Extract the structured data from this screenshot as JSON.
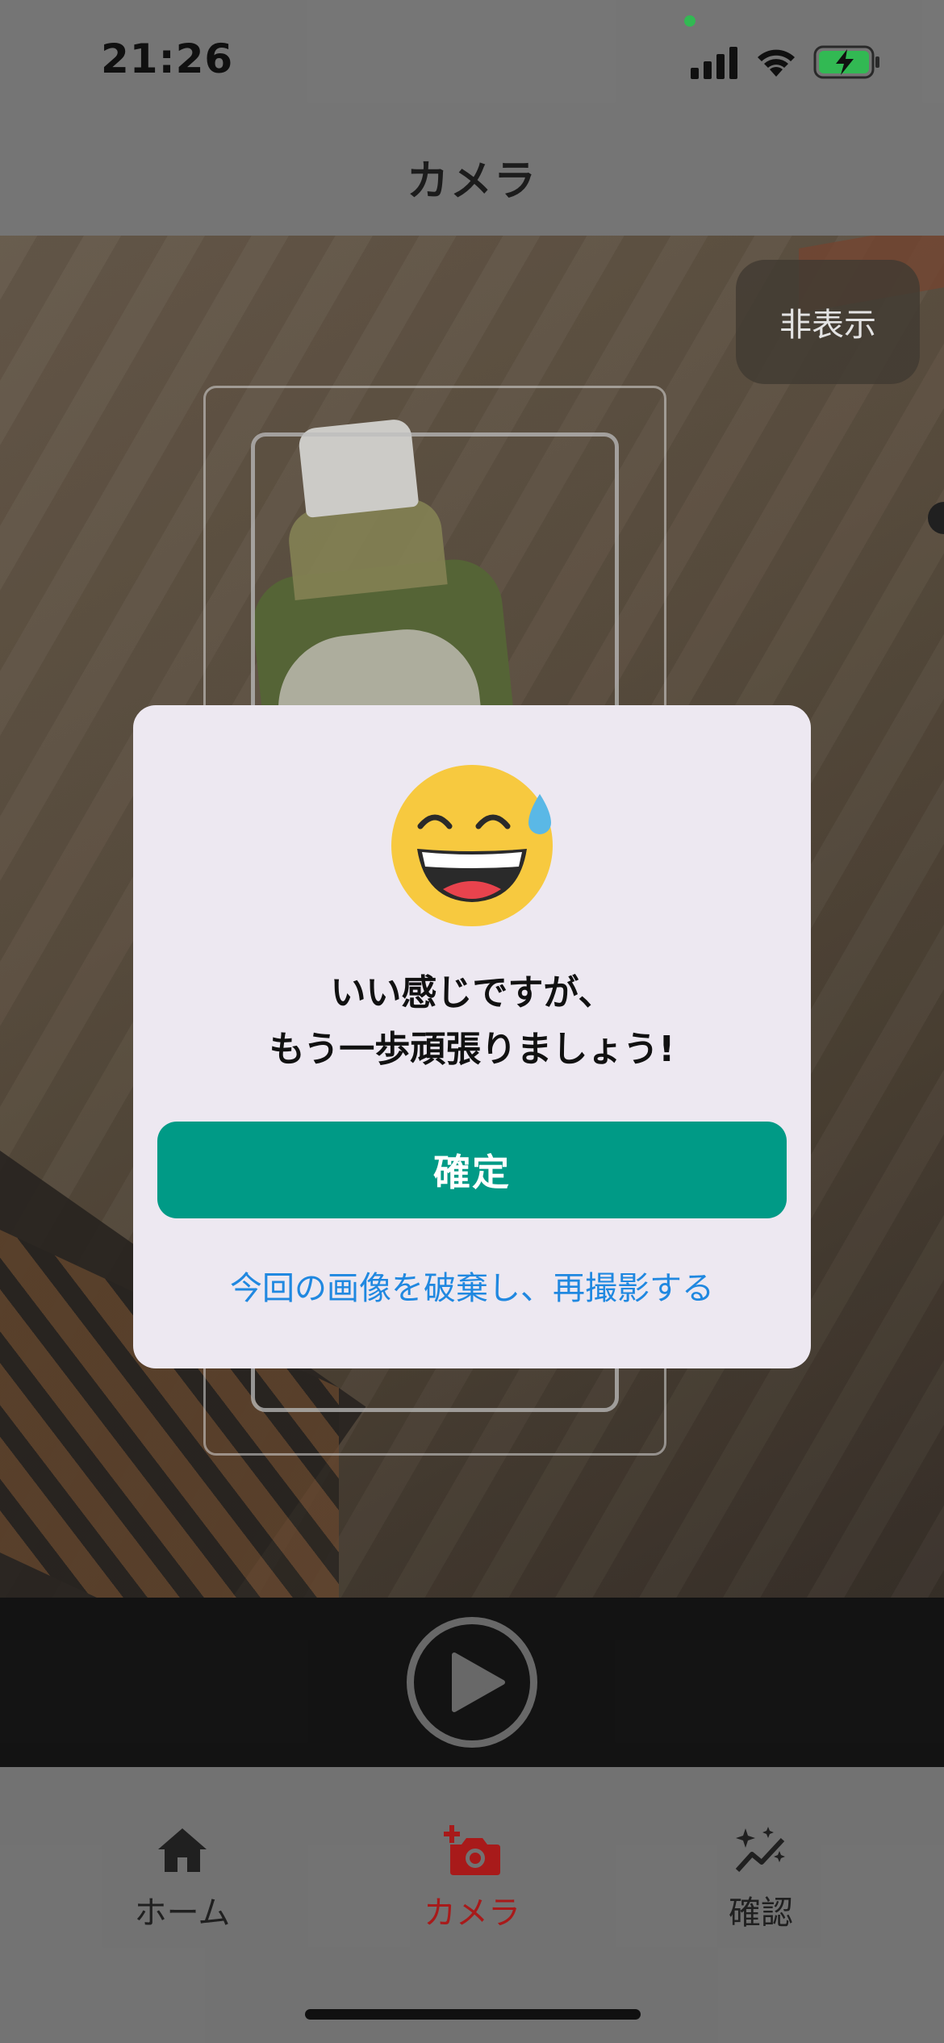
{
  "status_bar": {
    "time": "21:26",
    "icons": [
      "privacy-indicator-dot",
      "cellular-signal-icon",
      "wifi-icon",
      "battery-charging-icon"
    ],
    "privacy_dot_color": "#36c559"
  },
  "header": {
    "title": "カメラ"
  },
  "camera": {
    "hide_button_label": "非表示",
    "shutter_icon": "play-icon"
  },
  "modal": {
    "emoji": "grinning-face-with-sweat-icon",
    "message_line1": "いい感じですが、",
    "message_line2": "もう一歩頑張りましょう!",
    "confirm_label": "確定",
    "retake_label": "今回の画像を破棄し、再撮影する",
    "colors": {
      "confirm_button": "#009a86",
      "retake_link": "#2088e0",
      "background": "#ede8f1"
    }
  },
  "tab_bar": {
    "active": "カメラ",
    "active_color": "#b31c1c",
    "tabs": [
      {
        "label": "ホーム",
        "icon": "home-icon"
      },
      {
        "label": "カメラ",
        "icon": "add-camera-icon"
      },
      {
        "label": "確認",
        "icon": "sparkle-chart-icon"
      }
    ]
  }
}
